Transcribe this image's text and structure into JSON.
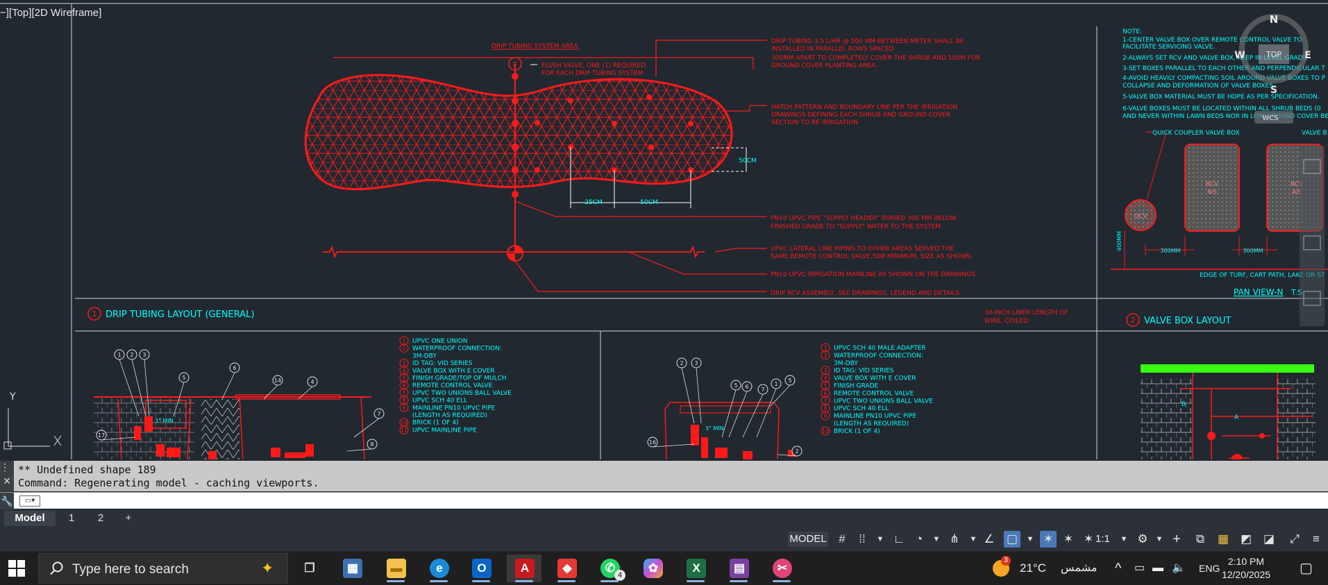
{
  "viewport": {
    "label": "−][Top][2D Wireframe]"
  },
  "view_cube": {
    "north": "N",
    "west": "W",
    "east": "E",
    "south": "S",
    "face": "TOP",
    "ucs": "WCS"
  },
  "drawing": {
    "drip": {
      "area_label": "DRIP TUBING SYSTEM AREA",
      "flush_valve": [
        "FLUSH VALVE, ONE (1) REQUIRED",
        "FOR EACH DRIP TUBING SYSTEM"
      ],
      "marker_f": "F",
      "note_tubing": [
        "DRIP TUBING 3.5 L/HR @ 500 MM BETWEEN METER SHALL BE",
        "INSTALLED IN PARALLEL ROWS SPACED",
        "300MM APART TO COMPLETELY COVER THE SHRUB AND 500M FOR",
        "GROUND COVER PLANTING AREA."
      ],
      "note_hatch": [
        "HATCH PATTERN AND BOUNDARY LINE PER THE IRRIGATION",
        "DRAWINGS DEFINING EACH SHRUB AND GROUND COVER",
        "SECTION TO BE IRRIGATION"
      ],
      "dim_side": "50CM",
      "dim_a": "25CM",
      "dim_b": "50CM",
      "note_supply": [
        "PN10 UPVC PIPE \"SUPPLY HEADER\" BURIED 300 MM BELOW",
        "FINISHED GRADE TO \"SUPPLY\" WATER TO THE SYSTEM."
      ],
      "note_lateral": [
        "UPVC LATERAL LINE PIPING TO OTHER AREAS SERVED THE",
        "SAME REMOTE CONTROL VALVE,50Ø MINIMUM, SIZE AS SHOWN."
      ],
      "note_mainline": "PN10 UPVC IRRIGATION MAINLINE AS SHOWN ON THE DRAWINGS.",
      "note_rcv": "DRIP RCV ASSEMBLY, SEE DRAWINGS, LEGEND AND DETAILS.",
      "title_num": "1",
      "title": "DRIP TUBING LAYOUT (GENERAL)",
      "wire_note": [
        "30-INCH LINER LENGTH OF",
        "WIRE, COILED"
      ]
    },
    "valve_box": {
      "notes": [
        "NOTE:",
        "1-CENTER VALVE BOX OVER REMOTE CONTROL VALVE TO",
        "FACILITATE SERVICING VALVE.",
        "2-ALWAYS SET RCV AND VALVE BOX, KEEP IN LEVEL GRADE",
        "3-SET BOXES PARALLEL TO EACH OTHER AND PERPENDICULAR T",
        "4-AVOID HEAVILY COMPACTING SOIL AROUND VALVE BOXES TO P",
        "COLLAPSE AND DEFORMATION OF VALVE BOXES.",
        "5-VALVE BOX MATERIAL MUST BE HDPE AS PER SPECIFICATION.",
        "6-VALVE BOXES MUST BE LOCATED WITHIN ALL SHRUB BEDS (0",
        "AND NEVER WITHIN LAWN BEDS NOR IN LOW GROUND COVER BE"
      ],
      "label_qcv_box": "QUICK COUPLER VALVE BOX",
      "label_valve_box": "VALVE B",
      "qcv": "QCV",
      "rcv1": [
        "RCV",
        "N/S"
      ],
      "rcv2": [
        "RCV",
        "A/S"
      ],
      "dim_400": "400MM",
      "dim_300a": "300MM",
      "dim_300b": "300MM",
      "edge_note": "EDGE OF TURF, CART PATH, LAKE OR ST",
      "pan_view": "PAN VIEW-N",
      "pan_view_suffix": "T.S",
      "title_num": "2",
      "title": "VALVE BOX LAYOUT"
    },
    "legend1": [
      "UPVC ONE UNION",
      "WATERPROOF CONNECTION:",
      "3M-DBY",
      "ID TAG: VID SERIES",
      "VALVE BOX WITH E COVER",
      "FINISH GRADE/TOP OF MULCH",
      "REMOTE CONTROL VALVE",
      "UPVC TWO UNIONS BALL VALVE",
      "UPVC SCH 40 ELL",
      "MAINLINE PN10 UPVC PIPE",
      "(LENGTH AS REQUIRED)",
      "BRICK (1 OF 4)",
      "UPVC MAINLINE PIPE"
    ],
    "legend1_nums": [
      "1",
      "2",
      "",
      "3",
      "4",
      "5",
      "6",
      "7",
      "8",
      "9",
      "",
      "10",
      "11"
    ],
    "legend2": [
      "UPVC SCH 40 MALE ADAPTER",
      "WATERPROOF CONNECTION:",
      "3M-DBY",
      "ID TAG: VID SERIES",
      "VALVE BOX WITH E COVER",
      "FINISH GRADE",
      "REMOTE CONTROL VALVE",
      "UPVC TWO UNIONS BALL VALVE",
      "UPVC SCH 40 ELL",
      "MAINLINE PN10 UPVC PIPE",
      "(LENGTH AS REQUIRED)",
      "BRICK (1 OF 4)"
    ],
    "legend2_nums": [
      "1",
      "2",
      "",
      "3",
      "4",
      "5",
      "6",
      "7",
      "8",
      "9",
      "",
      "10"
    ],
    "detail_min1": "3\" MIN",
    "detail_min2": "3\" MIN",
    "detail_callouts1": [
      "1",
      "2",
      "3",
      "5",
      "6",
      "14",
      "4",
      "7",
      "17",
      "8"
    ],
    "detail_callouts2": [
      "2",
      "3",
      "5",
      "6",
      "7",
      "1",
      "5",
      "16",
      "2"
    ],
    "section_a": "A",
    "section_b": "B"
  },
  "ucs_icon": {
    "y": "Y",
    "x": "X"
  },
  "command": {
    "history": [
      "** Undefined shape 189",
      "Command: Regenerating model - caching viewports."
    ],
    "input_value": "",
    "input_placeholder": ""
  },
  "layout_tabs": [
    "Model",
    "1",
    "2",
    "+"
  ],
  "status": {
    "model": "MODEL",
    "scale": "1:1"
  },
  "taskbar": {
    "search_placeholder": "Type here to search",
    "apps": [
      {
        "name": "task-view",
        "glyph": "☰"
      },
      {
        "name": "calculator",
        "glyph": "▦"
      },
      {
        "name": "file-explorer",
        "glyph": "▬"
      },
      {
        "name": "edge",
        "glyph": "e"
      },
      {
        "name": "outlook",
        "glyph": "O"
      },
      {
        "name": "autocad",
        "glyph": "A"
      },
      {
        "name": "anydesk",
        "glyph": "◆"
      },
      {
        "name": "whatsapp",
        "glyph": "☎"
      },
      {
        "name": "copilot",
        "glyph": "✿"
      },
      {
        "name": "excel",
        "glyph": "X"
      },
      {
        "name": "winrar",
        "glyph": "▤"
      },
      {
        "name": "snipping-tool",
        "glyph": "✂"
      }
    ],
    "whatsapp_badge": "4",
    "weather_badge": "3",
    "temperature": "21°C",
    "weather_text": "مشمس",
    "language": "ENG",
    "time": "2:10 PM",
    "date": "12/20/2025"
  },
  "colors": {
    "background": "#212830",
    "red": "#ff1a1a",
    "cyan": "#00ffff",
    "white": "#e8e8e8",
    "green": "#39ff14",
    "taskbar": "#1f1f1f",
    "accent": "#4a79b8"
  }
}
